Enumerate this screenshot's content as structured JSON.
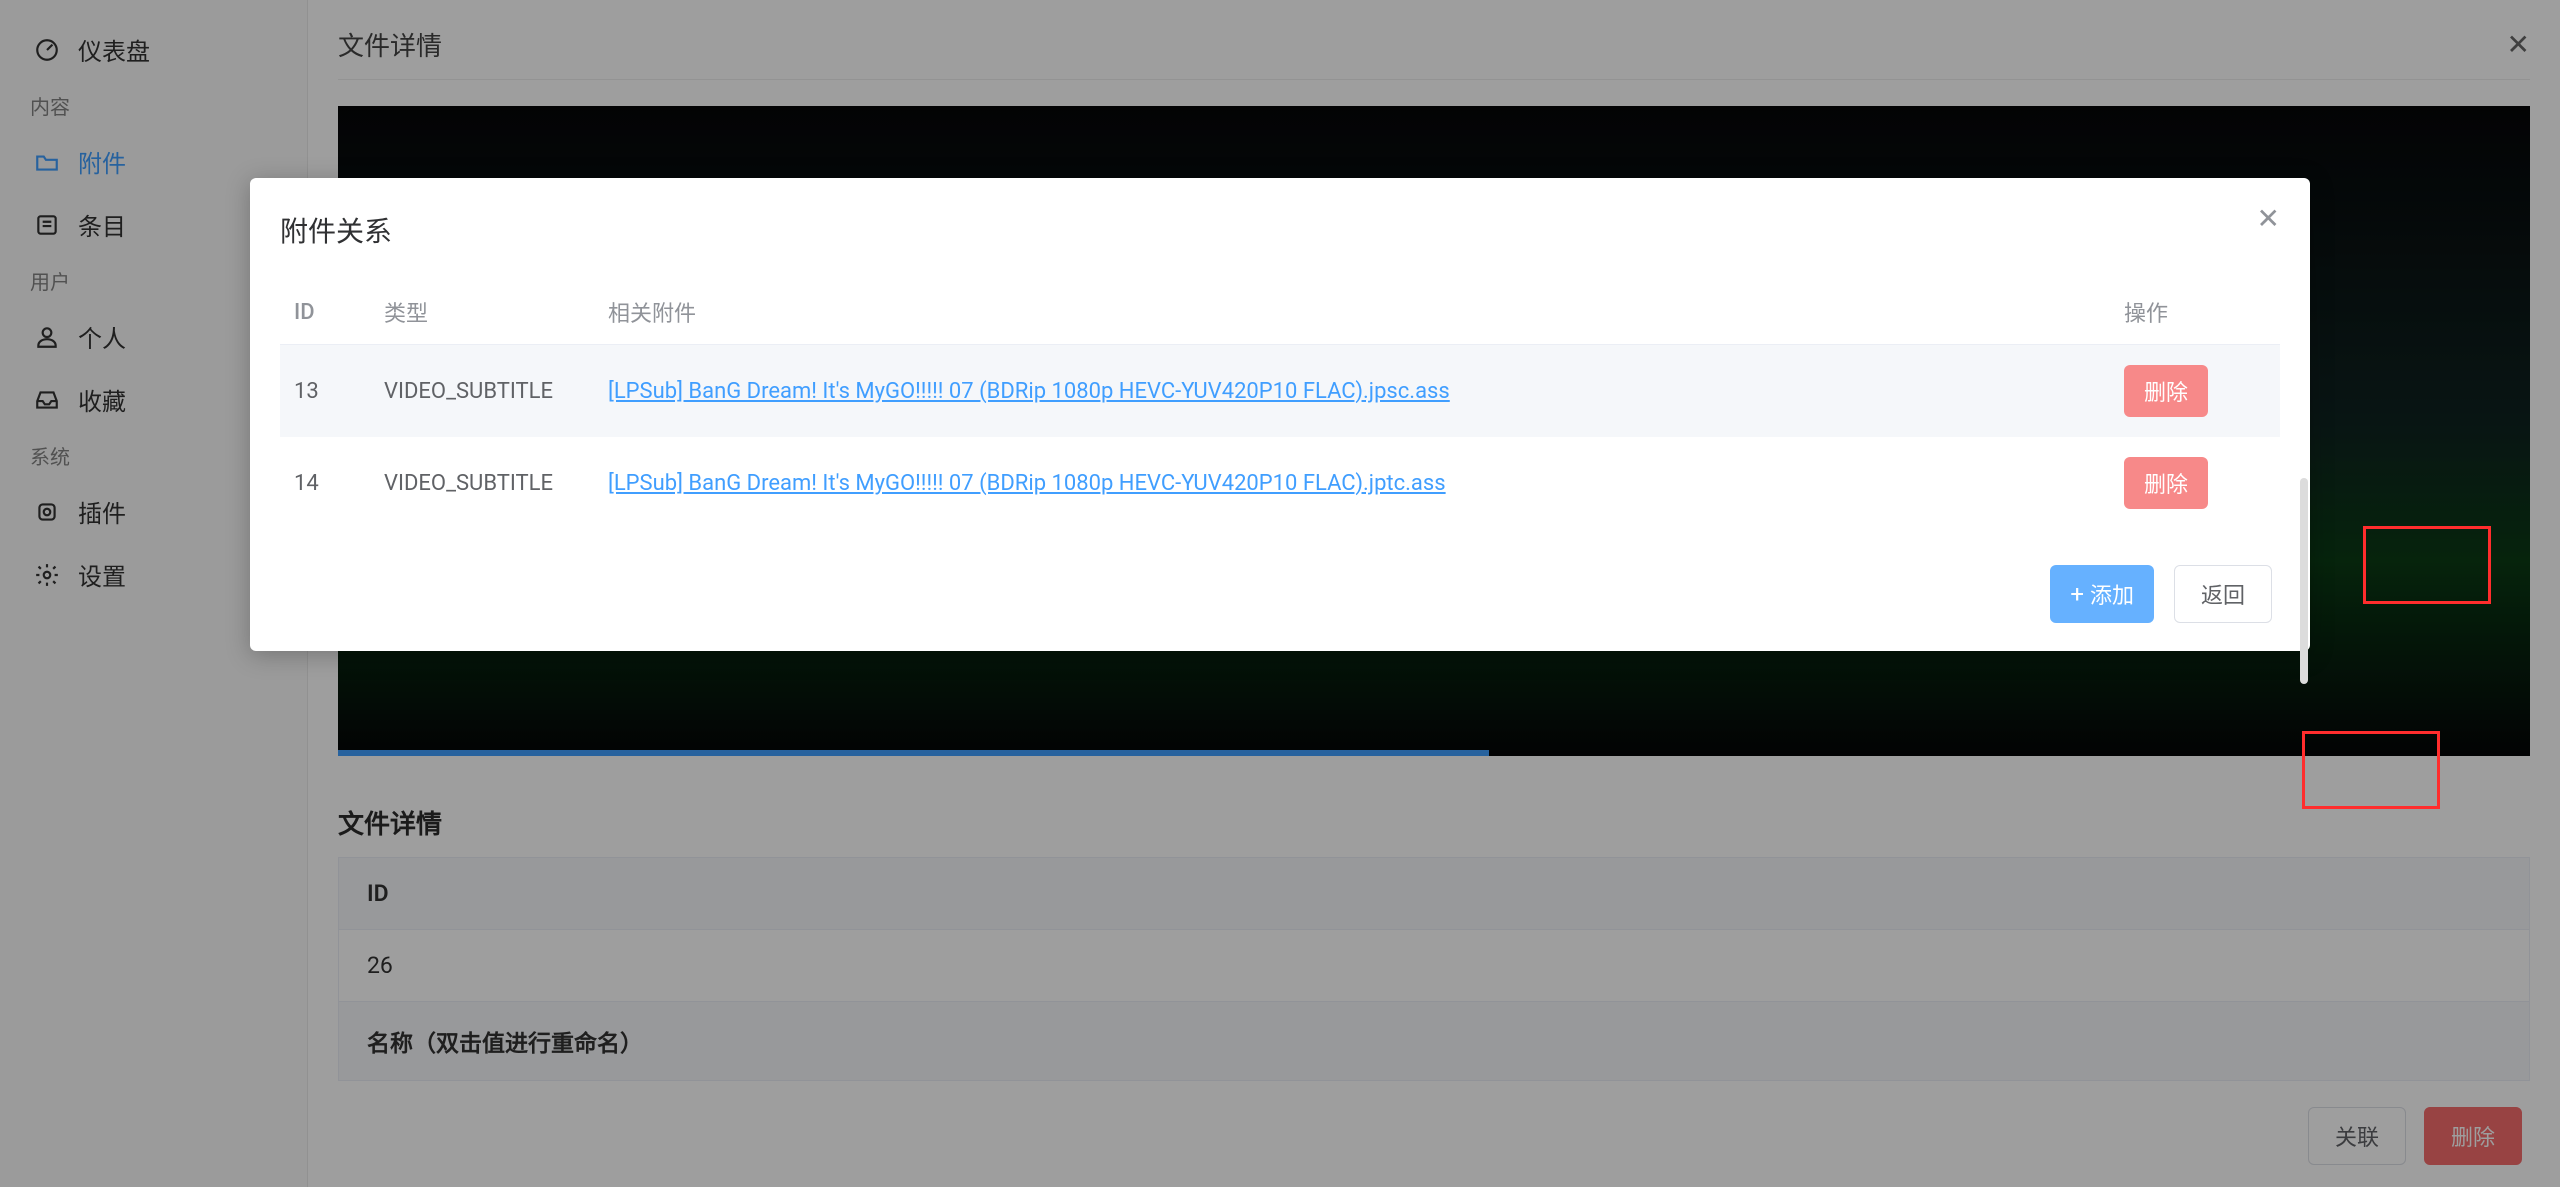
{
  "sidebar": {
    "dashboard": "仪表盘",
    "section_content": "内容",
    "attachments": "附件",
    "entries": "条目",
    "section_user": "用户",
    "personal": "个人",
    "favorites": "收藏",
    "section_system": "系统",
    "plugins": "插件",
    "settings": "设置"
  },
  "page": {
    "title": "文件详情",
    "section_title": "文件详情",
    "rows": {
      "id_label": "ID",
      "id_value": "26",
      "name_label": "名称（双击值进行重命名）"
    },
    "footer": {
      "relate": "关联",
      "delete": "删除"
    }
  },
  "modal": {
    "title": "附件关系",
    "columns": {
      "id": "ID",
      "type": "类型",
      "related": "相关附件",
      "action": "操作"
    },
    "rows": [
      {
        "id": "13",
        "type": "VIDEO_SUBTITLE",
        "file": "[LPSub] BanG Dream! It's MyGO!!!!! 07 (BDRip 1080p HEVC-YUV420P10 FLAC).jpsc.ass",
        "action": "删除"
      },
      {
        "id": "14",
        "type": "VIDEO_SUBTITLE",
        "file": "[LPSub] BanG Dream! It's MyGO!!!!! 07 (BDRip 1080p HEVC-YUV420P10 FLAC).jptc.ass",
        "action": "删除"
      }
    ],
    "footer": {
      "add": "添加",
      "back": "返回"
    }
  }
}
